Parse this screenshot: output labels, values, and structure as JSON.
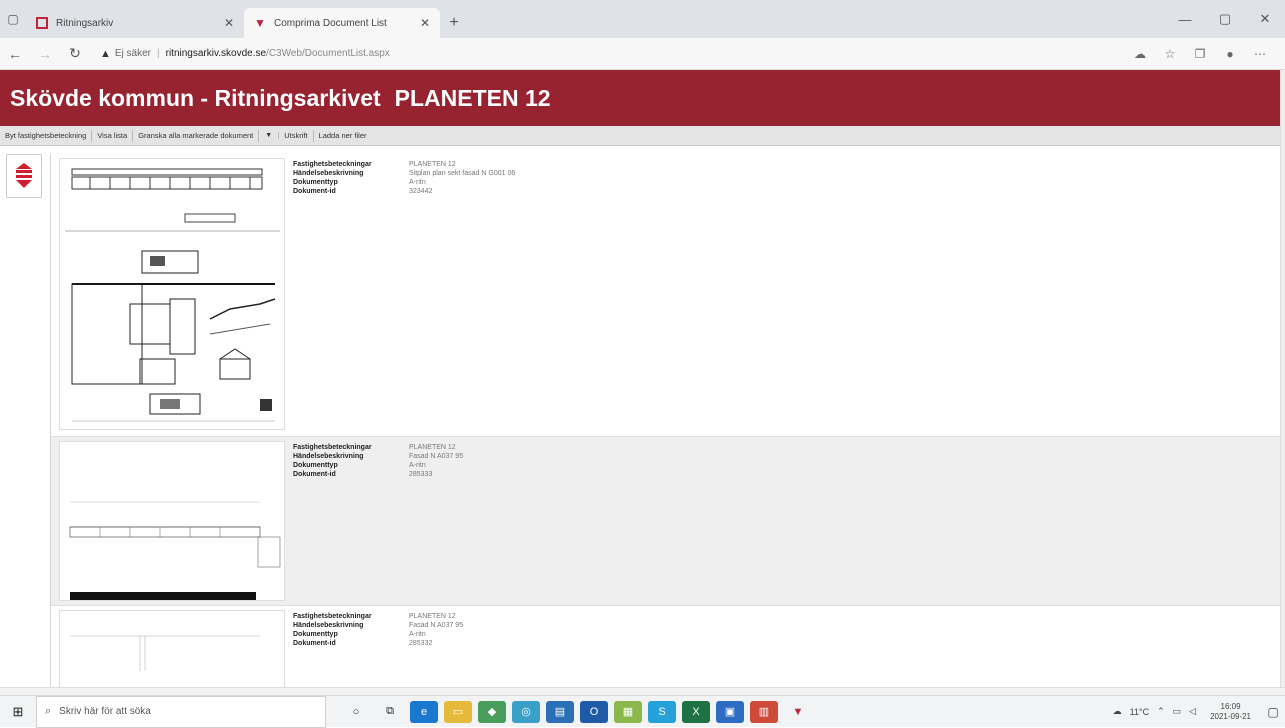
{
  "browser": {
    "tabs": [
      {
        "label": "Ritningsarkiv"
      },
      {
        "label": "Comprima Document List"
      }
    ],
    "address": {
      "security": "Ej säker",
      "host": "ritningsarkiv.skovde.se",
      "path": "/C3Web/DocumentList.aspx"
    }
  },
  "page": {
    "site_title": "Skövde kommun - Ritningsarkivet",
    "property": "PLANETEN 12"
  },
  "toolbar": {
    "items": [
      "Byt fastighetsbeteckning",
      "Visa lista",
      "Granska alla markerade dokument",
      "Utskrift",
      "Ladda ner filer"
    ]
  },
  "meta_labels": {
    "property": "Fastighetsbeteckningar",
    "event": "Händelsebeskrivning",
    "doctype": "Dokumenttyp",
    "docid": "Dokument-id"
  },
  "documents": [
    {
      "property": "PLANETEN 12",
      "event": "Sitplan plan sekt fasad N G001 06",
      "doctype": "A-ritn",
      "docid": "323442"
    },
    {
      "property": "PLANETEN 12",
      "event": "Fasad N A037 95",
      "doctype": "A-ritn",
      "docid": "285333"
    },
    {
      "property": "PLANETEN 12",
      "event": "Fasad N A037 95",
      "doctype": "A-ritn",
      "docid": "285332"
    }
  ],
  "taskbar": {
    "search_placeholder": "Skriv här för att söka",
    "weather": "11°C",
    "time": "16:09",
    "date": "2021-09-21"
  },
  "colors": {
    "brand": "#972230",
    "toolbar": "#e4e4e4",
    "alt_row": "#efefef"
  }
}
